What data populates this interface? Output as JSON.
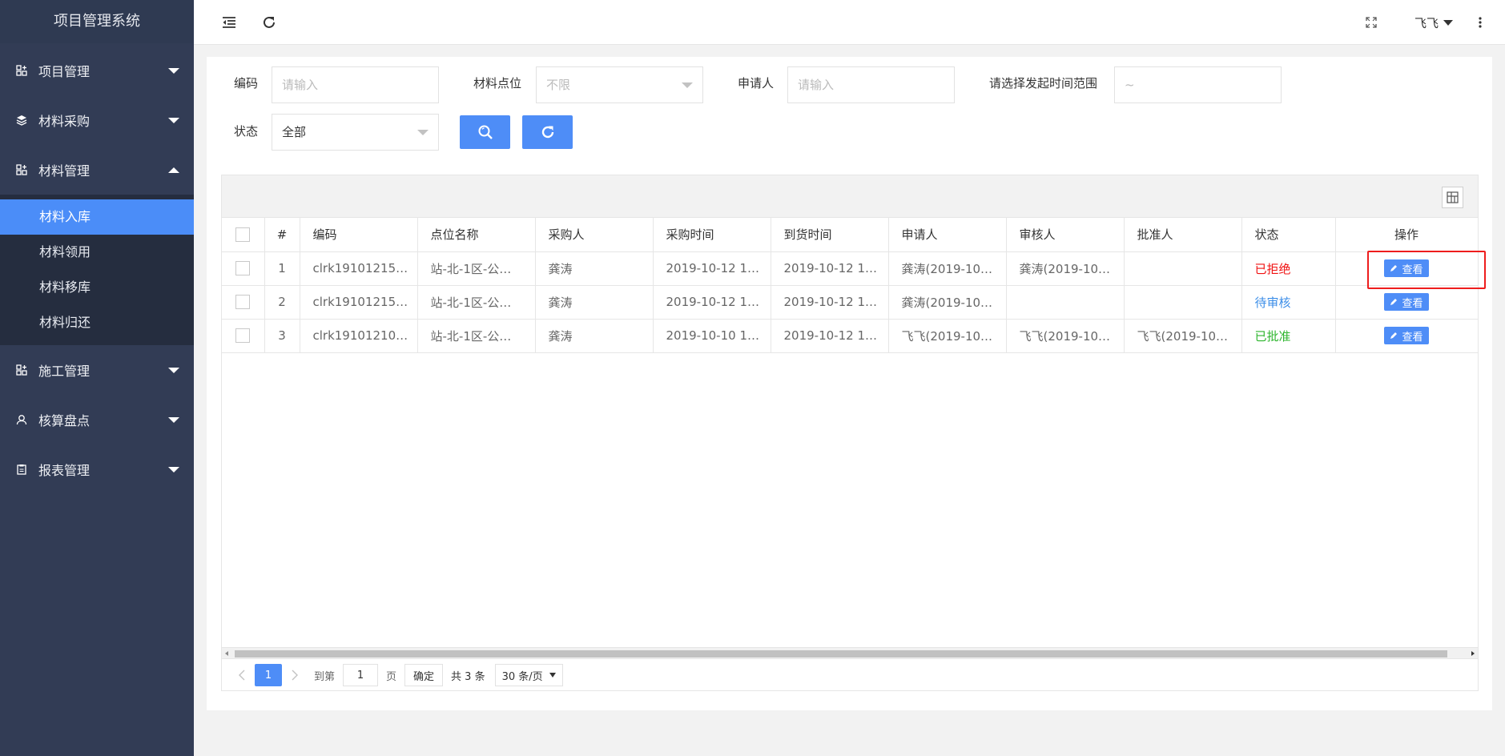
{
  "app": {
    "title": "项目管理系统"
  },
  "sidebar": {
    "items": [
      {
        "label": "项目管理",
        "icon": "grid-plus-icon",
        "expanded": false
      },
      {
        "label": "材料采购",
        "icon": "layers-icon",
        "expanded": false
      },
      {
        "label": "材料管理",
        "icon": "grid-plus-icon",
        "expanded": true,
        "children": [
          {
            "label": "材料入库",
            "active": true
          },
          {
            "label": "材料领用"
          },
          {
            "label": "材料移库"
          },
          {
            "label": "材料归还"
          }
        ]
      },
      {
        "label": "施工管理",
        "icon": "grid-plus-icon",
        "expanded": false
      },
      {
        "label": "核算盘点",
        "icon": "user-icon",
        "expanded": false
      },
      {
        "label": "报表管理",
        "icon": "clipboard-icon",
        "expanded": false
      }
    ]
  },
  "topbar": {
    "user_name": "飞飞"
  },
  "filters": {
    "code_label": "编码",
    "code_placeholder": "请输入",
    "location_label": "材料点位",
    "location_value": "不限",
    "applicant_label": "申请人",
    "applicant_placeholder": "请输入",
    "time_label": "请选择发起时间范围",
    "time_value": "~",
    "status_label": "状态",
    "status_value": "全部"
  },
  "table": {
    "headers": [
      "#",
      "编码",
      "点位名称",
      "采购人",
      "采购时间",
      "到货时间",
      "申请人",
      "审核人",
      "批准人",
      "状态",
      "操作"
    ],
    "rows": [
      {
        "no": "1",
        "code": "clrk19101215…",
        "location": "站-北-1区-公…",
        "buyer": "龚涛",
        "buy_time": "2019-10-12 1…",
        "arrive_time": "2019-10-12 1…",
        "applicant": "龚涛(2019-10…",
        "reviewer": "龚涛(2019-10…",
        "approver": "",
        "status": "已拒绝",
        "action": "查看"
      },
      {
        "no": "2",
        "code": "clrk19101215…",
        "location": "站-北-1区-公…",
        "buyer": "龚涛",
        "buy_time": "2019-10-12 1…",
        "arrive_time": "2019-10-12 1…",
        "applicant": "龚涛(2019-10…",
        "reviewer": "",
        "approver": "",
        "status": "待审核",
        "action": "查看"
      },
      {
        "no": "3",
        "code": "clrk19101210…",
        "location": "站-北-1区-公…",
        "buyer": "龚涛",
        "buy_time": "2019-10-10 1…",
        "arrive_time": "2019-10-12 1…",
        "applicant": "飞飞(2019-10…",
        "reviewer": "飞飞(2019-10…",
        "approver": "飞飞(2019-10…",
        "status": "已批准",
        "action": "查看"
      }
    ]
  },
  "pagination": {
    "current_page": "1",
    "goto_label": "到第",
    "goto_value": "1",
    "page_unit": "页",
    "confirm_label": "确定",
    "total_text": "共 3 条",
    "page_size": "30 条/页"
  },
  "colors": {
    "sidebar_bg": "#323c55",
    "accent": "#4e8df7",
    "status_rejected": "#f01010",
    "status_pending": "#3c8ee8",
    "status_approved": "#2db52d",
    "highlight": "#ee1d1d"
  }
}
